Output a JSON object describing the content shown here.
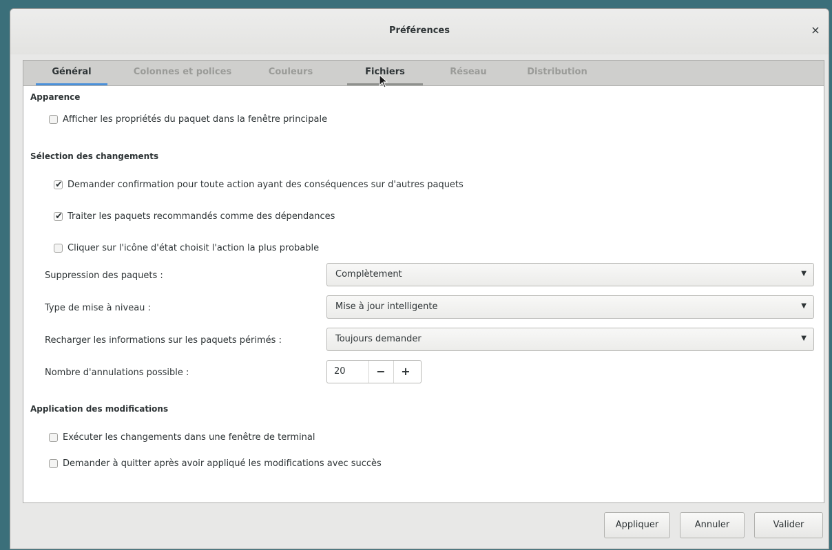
{
  "window": {
    "title": "Préférences",
    "close_glyph": "×"
  },
  "tabs": [
    {
      "label": "Général"
    },
    {
      "label": "Colonnes et polices"
    },
    {
      "label": "Couleurs"
    },
    {
      "label": "Fichiers"
    },
    {
      "label": "Réseau"
    },
    {
      "label": "Distribution"
    }
  ],
  "active_tab": "Général",
  "appearance": {
    "heading": "Apparence",
    "options": [
      {
        "label": "Afficher les propriétés du paquet dans la fenêtre principale",
        "checked": false
      }
    ]
  },
  "selection": {
    "heading": "Sélection des changements",
    "options": [
      {
        "label": "Demander confirmation pour toute action ayant des conséquences sur d'autres paquets",
        "checked": true
      },
      {
        "label": "Traiter les paquets recommandés comme des dépendances",
        "checked": true
      },
      {
        "label": "Cliquer sur l'icône d'état choisit l'action la plus probable",
        "checked": false
      }
    ],
    "fields": {
      "removal": {
        "label": "Suppression des paquets :",
        "value": "Complètement"
      },
      "upgrade": {
        "label": "Type de mise à niveau :",
        "value": "Mise à jour intelligente"
      },
      "reload": {
        "label": "Recharger les informations sur les paquets périmés :",
        "value": "Toujours demander"
      },
      "undo": {
        "label": "Nombre d'annulations possible :",
        "value": "20",
        "minus": "−",
        "plus": "+"
      }
    }
  },
  "apply": {
    "heading": "Application des modifications",
    "options": [
      {
        "label": "Exécuter les changements dans une fenêtre de terminal",
        "checked": false
      },
      {
        "label": "Demander à quitter après avoir appliqué les modifications avec succès",
        "checked": false
      }
    ]
  },
  "buttons": {
    "apply": "Appliquer",
    "cancel": "Annuler",
    "ok": "Valider"
  },
  "icons": {
    "checkmark": "✔",
    "dropdown": "▼"
  }
}
